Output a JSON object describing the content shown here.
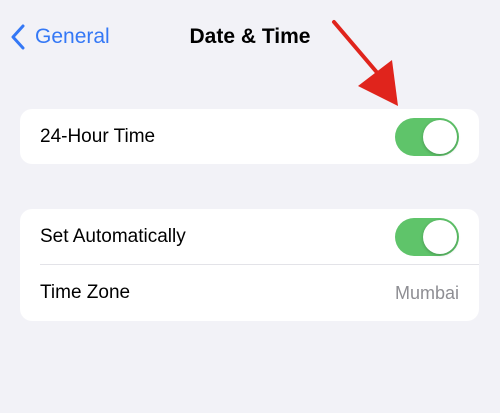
{
  "nav": {
    "back_label": "General",
    "title": "Date & Time",
    "back_icon": "chevron-left-icon"
  },
  "groups": [
    {
      "rows": [
        {
          "label": "24-Hour Time",
          "control": "toggle",
          "on": true
        }
      ]
    },
    {
      "rows": [
        {
          "label": "Set Automatically",
          "control": "toggle",
          "on": true
        },
        {
          "label": "Time Zone",
          "value": "Mumbai"
        }
      ]
    }
  ],
  "colors": {
    "accent": "#3478f6",
    "toggle_on": "#5fc46a",
    "background": "#f2f2f7",
    "annotation_arrow": "#e0241c",
    "secondary_text": "#8e8e93"
  }
}
